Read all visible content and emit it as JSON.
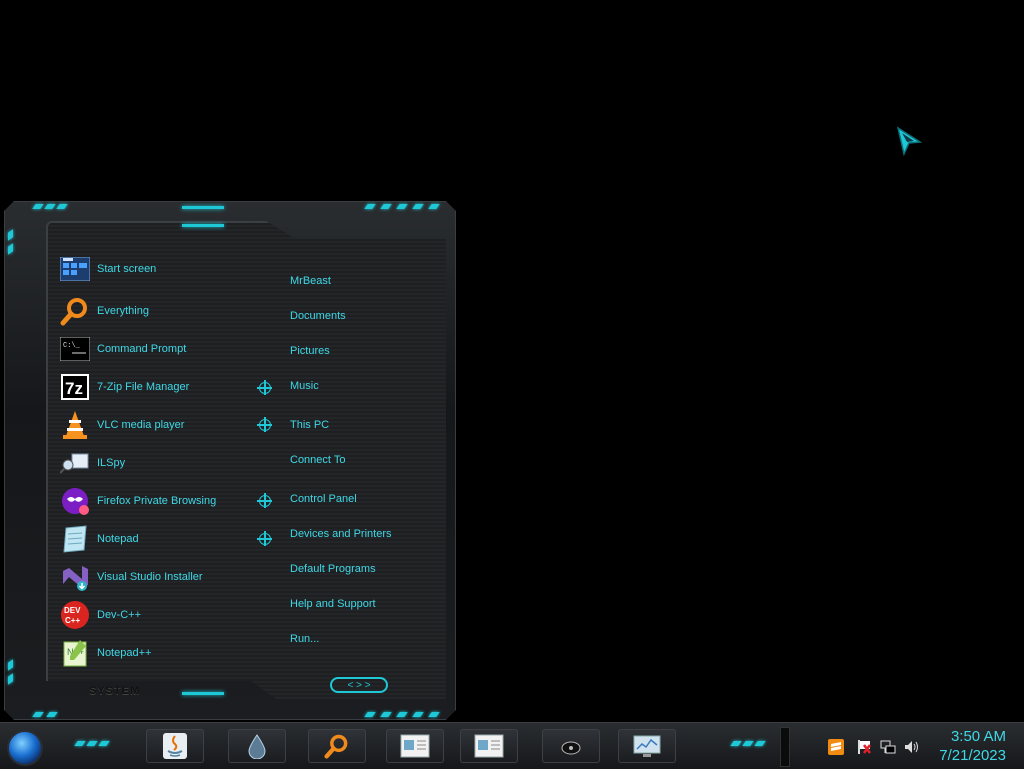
{
  "start_menu": {
    "system_label": "SYSTEM",
    "programs": [
      {
        "label": "Start screen",
        "icon": "start-screen-icon",
        "has_jumplist": false
      },
      {
        "label": "Everything",
        "icon": "magnifier-icon",
        "has_jumplist": false
      },
      {
        "label": "Command Prompt",
        "icon": "cmd-icon",
        "has_jumplist": false
      },
      {
        "label": "7-Zip File Manager",
        "icon": "7zip-icon",
        "has_jumplist": true
      },
      {
        "label": "VLC media player",
        "icon": "vlc-cone-icon",
        "has_jumplist": true
      },
      {
        "label": "ILSpy",
        "icon": "ilspy-icon",
        "has_jumplist": false
      },
      {
        "label": "Firefox Private Browsing",
        "icon": "firefox-private-icon",
        "has_jumplist": true
      },
      {
        "label": "Notepad",
        "icon": "notepad-icon",
        "has_jumplist": true
      },
      {
        "label": "Visual Studio Installer",
        "icon": "vs-installer-icon",
        "has_jumplist": false
      },
      {
        "label": "Dev-C++",
        "icon": "devcpp-icon",
        "has_jumplist": false
      },
      {
        "label": "Notepad++",
        "icon": "notepadpp-icon",
        "has_jumplist": false
      }
    ],
    "places": [
      {
        "label": "MrBeast"
      },
      {
        "label": "Documents"
      },
      {
        "label": "Pictures"
      },
      {
        "label": "Music"
      },
      {
        "label": "This PC"
      },
      {
        "label": "Connect To"
      },
      {
        "label": "Control Panel"
      },
      {
        "label": "Devices and Printers"
      },
      {
        "label": "Default Programs"
      },
      {
        "label": "Help and Support"
      },
      {
        "label": "Run..."
      }
    ],
    "nav_arrows": "< > >"
  },
  "taskbar": {
    "pinned": [
      "java-icon",
      "water-drop-icon",
      "magnifier-icon",
      "document-window-icon",
      "document-window-icon",
      "disc-icon",
      "monitor-icon"
    ],
    "tray_icons": [
      "sublime-icon",
      "flag-icon",
      "network-icon",
      "volume-icon"
    ],
    "clock_time": "3:50 AM",
    "clock_date": "7/21/2023"
  },
  "colors": {
    "accent": "#1fc8d6",
    "text": "#3fd8e6",
    "background": "#000000"
  }
}
